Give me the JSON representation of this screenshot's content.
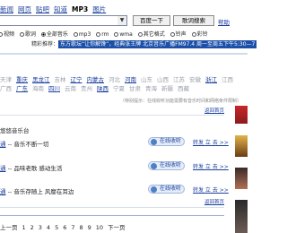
{
  "nav": [
    "新闻",
    "网页",
    "贴吧",
    "知道",
    "MP3",
    "图片"
  ],
  "search": {
    "value": "",
    "dropdown_icon": "chevron-down-icon",
    "search_button": "百度一下",
    "lyric_button": "歌词搜索",
    "help_link": "帮助"
  },
  "filters": [
    "视频",
    "歌词",
    "全部音乐",
    "mp3",
    "rm",
    "wma",
    "其它格式",
    "铃声",
    "彩铃"
  ],
  "hot": {
    "label": "精彩推荐：",
    "text": "东方歌坛“让你解馋”，经典张王牌 北京音乐广播FM97.4 周一至周五下午5:30—7"
  },
  "regions": {
    "row1": [
      "天津",
      "重庆",
      "黑龙江",
      "吉林",
      "辽宁",
      "内蒙古",
      "河北",
      "河南",
      "山东",
      "山西",
      "江苏",
      "安徽",
      "浙江",
      "江西"
    ],
    "row2": [
      "广西",
      "广东",
      "海南",
      "四川",
      "云南",
      "贵州",
      "陕西",
      "宁夏",
      "甘肃",
      "青海",
      "新疆",
      "西藏"
    ]
  },
  "note": "（特别提示：在线收听功能需要有音乐时间和网络条件限制）",
  "more_link": "返回首页",
  "section_title": "悠悠音乐台",
  "tracks": [
    {
      "channel": "通",
      "desc": "-- 音乐不断一切"
    },
    {
      "channel": "通",
      "desc": "-- 品味老歌 感动生活"
    },
    {
      "channel": "通",
      "desc": "-- 音乐存随上 风靡在耳边"
    }
  ],
  "track_play": "在线收听",
  "track_share": "转发 立 去 >>",
  "pager": [
    "上一页",
    "1",
    "2",
    "3",
    "4",
    "5",
    "6",
    "7",
    "8",
    "9",
    "10",
    "下一页"
  ]
}
